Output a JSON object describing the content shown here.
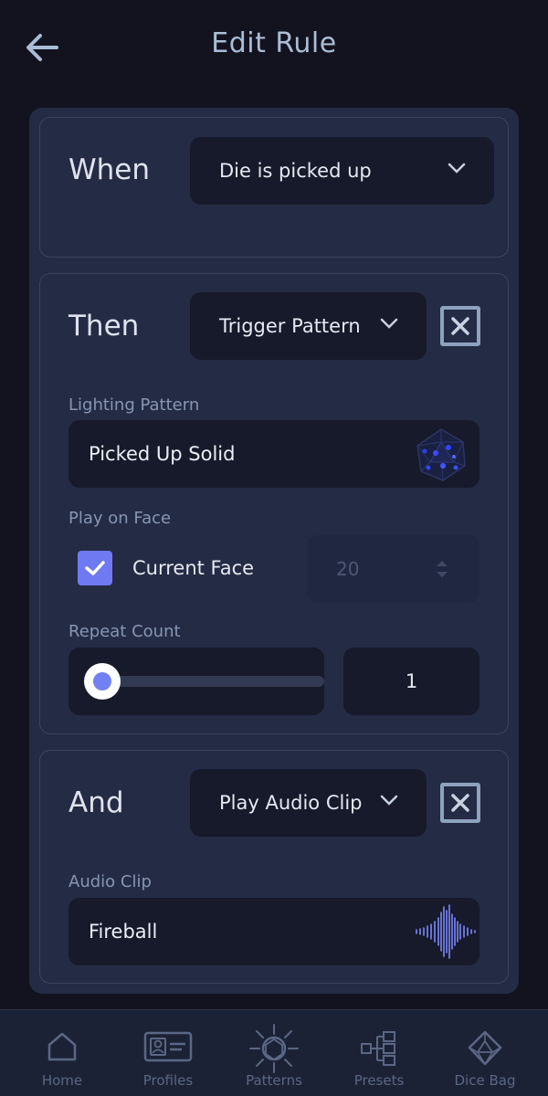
{
  "header": {
    "title": "Edit Rule",
    "back_icon": "arrow-left-icon"
  },
  "when_section": {
    "label": "When",
    "trigger_value": "Die is picked up"
  },
  "then_section": {
    "label": "Then",
    "action_value": "Trigger Pattern",
    "lighting_pattern_label": "Lighting Pattern",
    "lighting_pattern_value": "Picked Up Solid",
    "play_on_face_label": "Play on Face",
    "current_face_label": "Current Face",
    "current_face_checked": true,
    "face_value": "20",
    "repeat_count_label": "Repeat Count",
    "repeat_count_value": "1",
    "repeat_slider_fraction": 0
  },
  "and_section": {
    "label": "And",
    "action_value": "Play Audio Clip",
    "audio_clip_label": "Audio Clip",
    "audio_clip_value": "Fireball"
  },
  "nav": {
    "items": [
      {
        "label": "Home",
        "icon": "home-icon"
      },
      {
        "label": "Profiles",
        "icon": "id-card-icon"
      },
      {
        "label": "Patterns",
        "icon": "sun-pattern-icon"
      },
      {
        "label": "Presets",
        "icon": "hierarchy-icon"
      },
      {
        "label": "Dice Bag",
        "icon": "d20-dice-icon"
      }
    ]
  },
  "colors": {
    "background": "#13131f",
    "panel": "#242b44",
    "field": "#161a2a",
    "accent": "#6f79f2",
    "title": "#a9bdd6",
    "nav_inactive": "#5a6785"
  }
}
